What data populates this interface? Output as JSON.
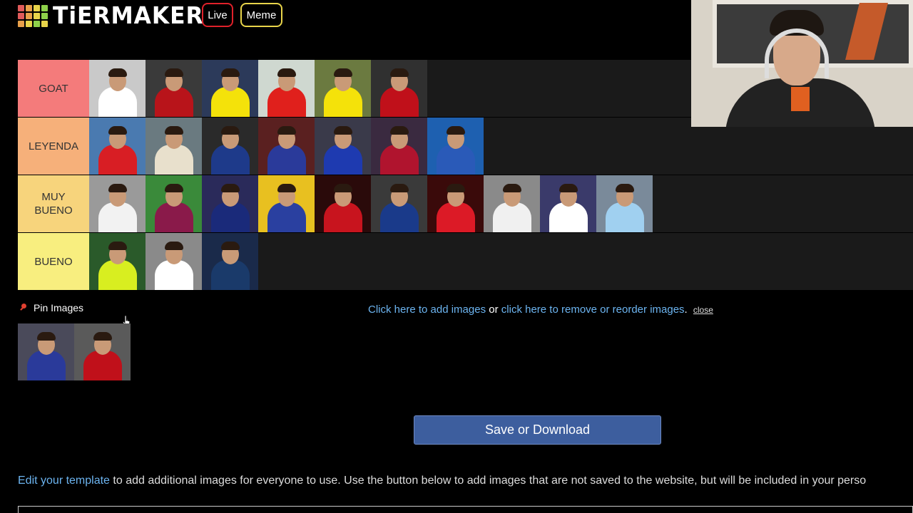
{
  "header": {
    "logo_text": "TiERMAKER",
    "logo_colors": [
      "#e05b5b",
      "#e8a04a",
      "#e8d44a",
      "#8ed24a",
      "#e05b5b",
      "#e8a04a",
      "#e8d44a",
      "#8ed24a",
      "#e8a04a",
      "#e8d44a",
      "#8ed24a",
      "#e8d44a"
    ],
    "live_label": "Live",
    "meme_label": "Meme"
  },
  "tiers": [
    {
      "label": "GOAT",
      "color": "#f47b7b",
      "items": [
        {
          "bg": "#c9c9c9",
          "kit": "#ffffff"
        },
        {
          "bg": "#3a3a3a",
          "kit": "#b8141a"
        },
        {
          "bg": "#2c3a5a",
          "kit": "#f4e20a"
        },
        {
          "bg": "#cfd8d0",
          "kit": "#e0201c"
        },
        {
          "bg": "#6b7a40",
          "kit": "#f4e20a"
        },
        {
          "bg": "#303030",
          "kit": "#c0101a"
        }
      ]
    },
    {
      "label": "LEYENDA",
      "color": "#f6b07a",
      "items": [
        {
          "bg": "#4a7ab0",
          "kit": "#d81e24"
        },
        {
          "bg": "#6a7a80",
          "kit": "#e8e0cc"
        },
        {
          "bg": "#2a2a2a",
          "kit": "#1e3a8a"
        },
        {
          "bg": "#5a2020",
          "kit": "#2a3a9a"
        },
        {
          "bg": "#3a3a4a",
          "kit": "#1e3ab0"
        },
        {
          "bg": "#3a2a40",
          "kit": "#b0142e"
        },
        {
          "bg": "#1e60b0",
          "kit": "#2a5ab8"
        }
      ]
    },
    {
      "label": "MUY BUENO",
      "color": "#f7d47c",
      "items": [
        {
          "bg": "#9a9a9a",
          "kit": "#f2f2f2"
        },
        {
          "bg": "#3a8a3a",
          "kit": "#8a1a4a"
        },
        {
          "bg": "#2a2a5a",
          "kit": "#1a2a7a"
        },
        {
          "bg": "#e8c020",
          "kit": "#2a40a0"
        },
        {
          "bg": "#2a0a0a",
          "kit": "#c8141e"
        },
        {
          "bg": "#3a3a3a",
          "kit": "#1a3a8a"
        },
        {
          "bg": "#3a0a0a",
          "kit": "#dc1a26"
        },
        {
          "bg": "#8a8a8a",
          "kit": "#f0f0f0"
        },
        {
          "bg": "#3a3a6a",
          "kit": "#ffffff"
        },
        {
          "bg": "#7a8a9a",
          "kit": "#a0d0f0"
        }
      ]
    },
    {
      "label": "BUENO",
      "color": "#f8ee7f",
      "items": [
        {
          "bg": "#2a5a2a",
          "kit": "#d8ee20"
        },
        {
          "bg": "#8a8a8a",
          "kit": "#ffffff"
        },
        {
          "bg": "#1a2a4a",
          "kit": "#1a3a6a"
        }
      ]
    }
  ],
  "pin": {
    "label": "Pin Images"
  },
  "pool_items": [
    {
      "bg": "#4a4a5a",
      "kit": "#2a3a9a"
    },
    {
      "bg": "#5a5a5a",
      "kit": "#c0101a"
    }
  ],
  "links": {
    "add_images": "Click here to add images",
    "or": "or",
    "remove_reorder": "click here to remove or reorder images",
    "period": ".",
    "close": "close"
  },
  "save_label": "Save or Download",
  "footer": {
    "edit_link": "Edit your template",
    "text": " to add additional images for everyone to use. Use the button below to add images that are not saved to the website, but will be included in your perso"
  }
}
